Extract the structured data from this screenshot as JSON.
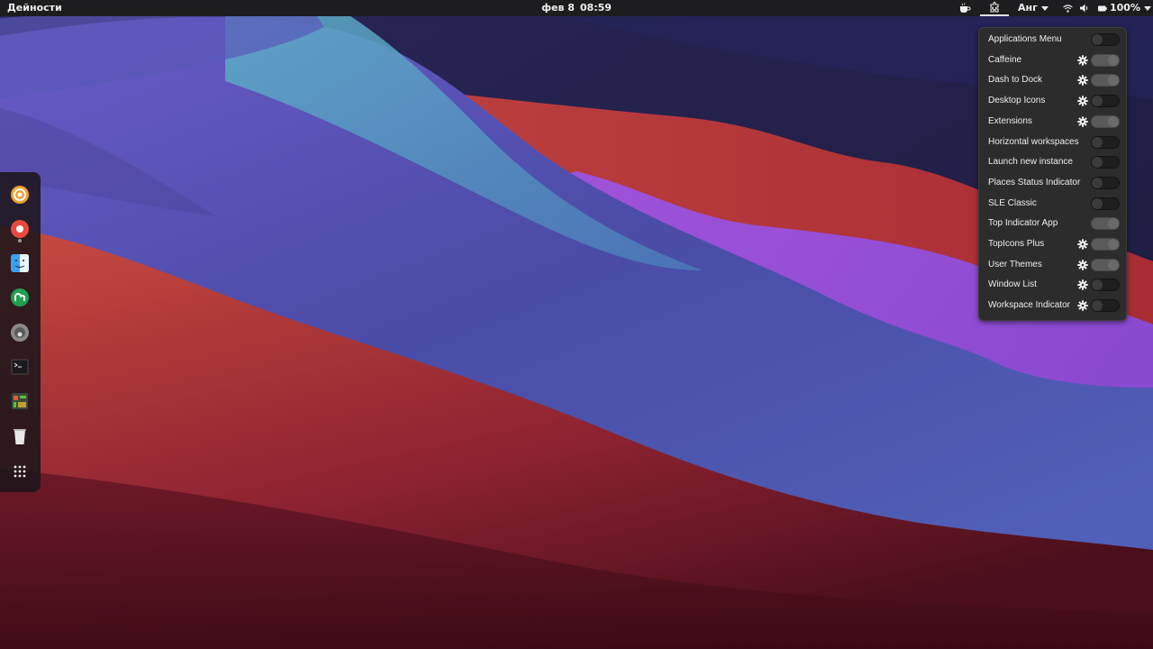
{
  "topbar": {
    "activities": "Дейности",
    "clock_date": "фев 8",
    "clock_time": "08:59",
    "language": "Анг",
    "battery": "100%"
  },
  "tray_icons": [
    "caffeine-cup-icon",
    "extensions-indicator-icon",
    "dropdown-arrow-icon",
    "wifi-icon",
    "volume-icon",
    "battery-icon",
    "dropdown-arrow-icon"
  ],
  "dock": {
    "items": [
      {
        "name": "ubuntu-software-icon"
      },
      {
        "name": "screen-recorder-icon",
        "running": true
      },
      {
        "name": "finder-icon"
      },
      {
        "name": "mastodon-app-icon"
      },
      {
        "name": "disk-utility-icon"
      },
      {
        "name": "terminal-icon"
      },
      {
        "name": "system-monitor-icon"
      },
      {
        "name": "trash-icon"
      },
      {
        "name": "show-applications-icon"
      }
    ]
  },
  "extensions": {
    "items": [
      {
        "label": "Applications Menu",
        "has_settings": false,
        "enabled": false
      },
      {
        "label": "Caffeine",
        "has_settings": true,
        "enabled": true
      },
      {
        "label": "Dash to Dock",
        "has_settings": true,
        "enabled": true
      },
      {
        "label": "Desktop Icons",
        "has_settings": true,
        "enabled": false
      },
      {
        "label": "Extensions",
        "has_settings": true,
        "enabled": true
      },
      {
        "label": "Horizontal workspaces",
        "has_settings": false,
        "enabled": false
      },
      {
        "label": "Launch new instance",
        "has_settings": false,
        "enabled": false
      },
      {
        "label": "Places Status Indicator",
        "has_settings": false,
        "enabled": false
      },
      {
        "label": "SLE Classic",
        "has_settings": false,
        "enabled": false
      },
      {
        "label": "Top Indicator App",
        "has_settings": false,
        "enabled": true
      },
      {
        "label": "TopIcons Plus",
        "has_settings": true,
        "enabled": true
      },
      {
        "label": "User Themes",
        "has_settings": true,
        "enabled": true
      },
      {
        "label": "Window List",
        "has_settings": true,
        "enabled": false
      },
      {
        "label": "Workspace Indicator",
        "has_settings": true,
        "enabled": false
      }
    ]
  },
  "colors": {
    "topbar": "#1d1d1f",
    "menu_bg": "#2c2c2c",
    "wallpaper_red": "#b53a3a",
    "wallpaper_blue": "#4a4aa0",
    "wallpaper_teal": "#5aa0c0",
    "wallpaper_purple": "#a050d0",
    "wallpaper_navy": "#22204a"
  }
}
